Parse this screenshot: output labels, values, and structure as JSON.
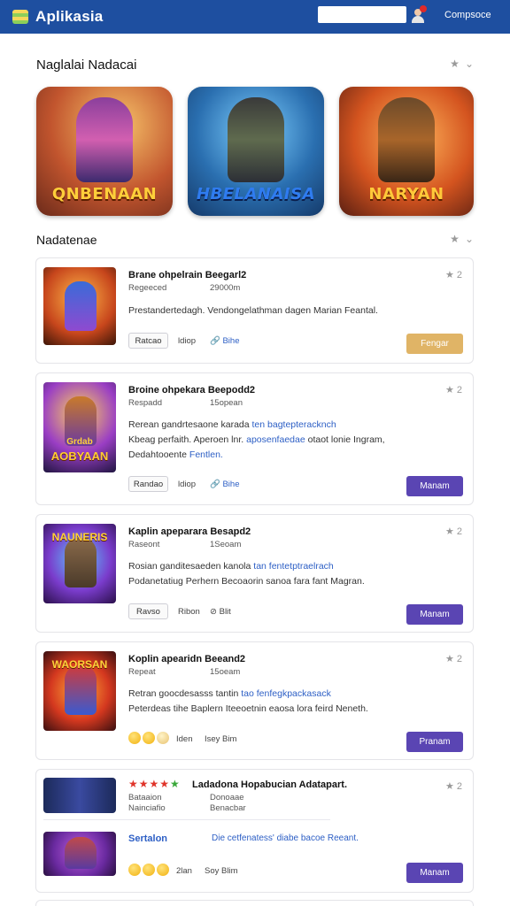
{
  "app": {
    "title": "Aplikasia",
    "top_link": "Compsoce"
  },
  "search": {
    "placeholder": ""
  },
  "featured_section": {
    "title": "Naglalai Nadacai"
  },
  "featured": [
    {
      "label": "QNBENAAN"
    },
    {
      "label": "HBELANAISA"
    },
    {
      "label": "NARYAN"
    }
  ],
  "list_section": {
    "title": "Nadatenae"
  },
  "cards": [
    {
      "title": "Brane ohpelrain Beegarl2",
      "meta_left": "Regeeced",
      "meta_right": "29000m",
      "desc_lines": [
        [
          {
            "t": "Prestandertedagh. Vendongelathman dagen Marian Feantal."
          }
        ]
      ],
      "fav": "2",
      "chip": "Ratcao",
      "small_meta": "ldiop",
      "link_meta": "Bihe",
      "button": "Fengar"
    },
    {
      "title": "Broine ohpekara Beepodd2",
      "meta_left": "Respadd",
      "meta_right": "15opean",
      "thumb_caption_top": "Grdab",
      "thumb_caption": "AOBYAAN",
      "desc_lines": [
        [
          {
            "t": "Rerean gandrtesaone karada "
          },
          {
            "t": "ten bagtepteracknch",
            "hl": true
          }
        ],
        [
          {
            "t": "Kbeag perfaith. Aperoen lnr. "
          },
          {
            "t": "aposenfaedae",
            "hl": true
          },
          {
            "t": " otaot lonie Ingram,"
          }
        ],
        [
          {
            "t": "Dedahtooente "
          },
          {
            "t": "Fentlen.",
            "hl": true
          }
        ]
      ],
      "fav": "2",
      "chip": "Randao",
      "small_meta": "ldiop",
      "link_meta": "Bihe",
      "button": "Manam"
    },
    {
      "title": "Kaplin apeparara Besapd2",
      "meta_left": "Raseont",
      "meta_right": "1Seoam",
      "thumb_caption": "NAUNERIS",
      "desc_lines": [
        [
          {
            "t": "Rosian ganditesaeden kanola "
          },
          {
            "t": "tan fentetptraelrach",
            "hl": true
          }
        ],
        [
          {
            "t": "Podanetatiug Perhern Becoaorin sanoa fara fant Magran."
          }
        ]
      ],
      "fav": "2",
      "chip": "Ravso",
      "small_meta": "Ribon",
      "link_meta": "Blit",
      "button": "Manam"
    },
    {
      "title": "Koplin apearidn Beeand2",
      "meta_left": "Repeat",
      "meta_right": "15oeam",
      "thumb_caption": "WAORSAN",
      "desc_lines": [
        [
          {
            "t": "Retran goocdesasss tantin "
          },
          {
            "t": "tao fenfegkpackasack",
            "hl": true
          }
        ],
        [
          {
            "t": "Peterdeas tihe Baplern Iteeoetnin eaosa lora feird Neneth."
          }
        ]
      ],
      "fav": "2",
      "small_meta": "Iden",
      "link_meta_plain": "Isey  Bim",
      "button": "Pranam"
    },
    {
      "title_prefix": "Ladadona",
      "title": "Hopabucian Adatapart.",
      "meta_left": "Bataaion",
      "meta_right": "Donoaae",
      "meta_left2": "Nainciafio",
      "meta_right2": "Benacbar",
      "fav": "2",
      "sub_title": "Sertalon",
      "sub_desc": "Die cetfenatess' diabe bacoe Reeant.",
      "small_meta": "2lan",
      "link_meta_plain": "Soy  Blim",
      "button": "Manam"
    }
  ],
  "colors": {
    "topbar": "#1e4fa0",
    "primary_button": "#5a45b3",
    "gold_button": "#e0b466",
    "link": "#2d5fc5"
  },
  "icons": [
    "list-logo-icon",
    "user-avatar-icon",
    "star-icon",
    "chevron-down-icon",
    "link-icon",
    "coin-icon"
  ]
}
